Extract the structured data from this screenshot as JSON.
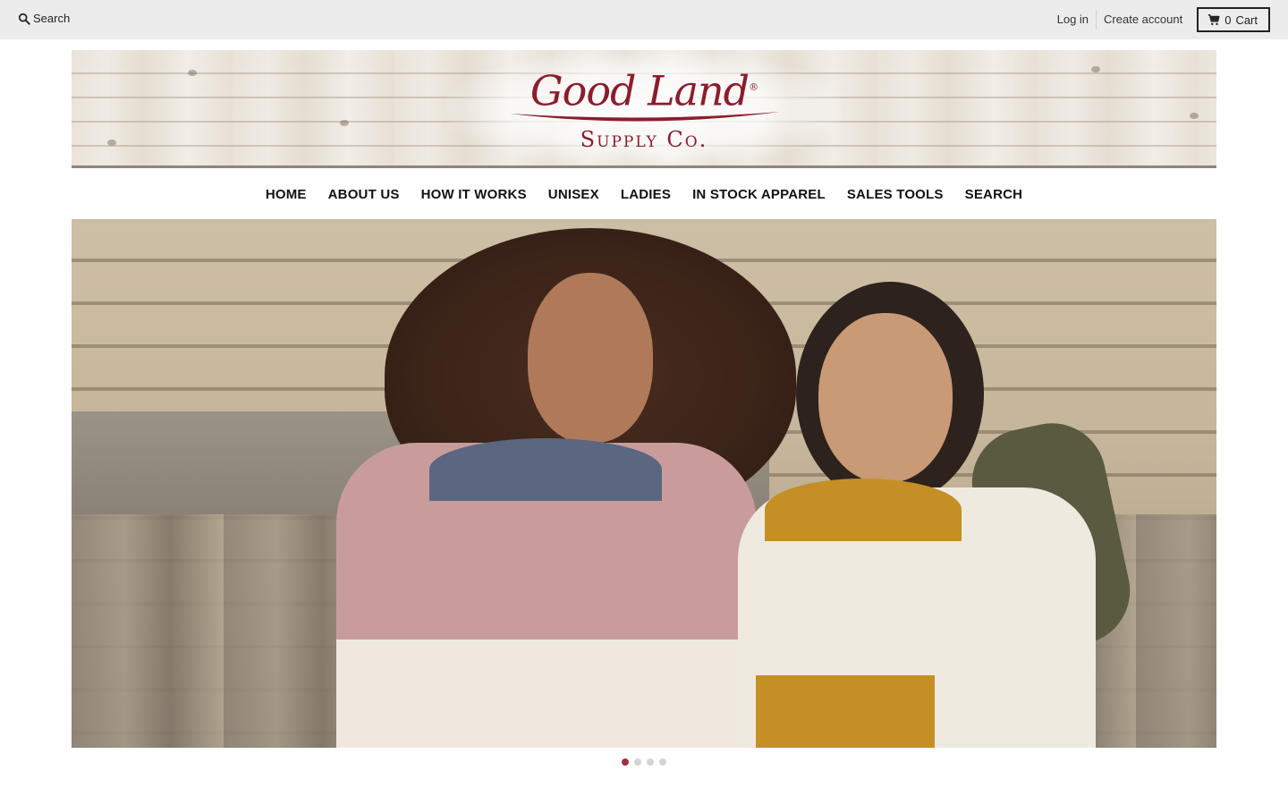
{
  "topbar": {
    "search_label": "Search",
    "search_icon": "search-icon",
    "login_label": "Log in",
    "create_account_label": "Create account",
    "cart_count": "0",
    "cart_label": "Cart",
    "cart_icon": "cart-icon"
  },
  "banner": {
    "logo_main": "Good Land",
    "logo_sub": "Supply Co.",
    "logo_mark": "®",
    "brand_color": "#8b1d2c"
  },
  "nav": {
    "items": [
      {
        "label": "HOME"
      },
      {
        "label": "ABOUT US"
      },
      {
        "label": "HOW IT WORKS"
      },
      {
        "label": "UNISEX"
      },
      {
        "label": "LADIES"
      },
      {
        "label": "IN STOCK APPAREL"
      },
      {
        "label": "SALES TOOLS"
      },
      {
        "label": "SEARCH"
      }
    ]
  },
  "hero": {
    "slide_count": 4,
    "active_slide": 1,
    "active_dot_color": "#9b3244"
  }
}
